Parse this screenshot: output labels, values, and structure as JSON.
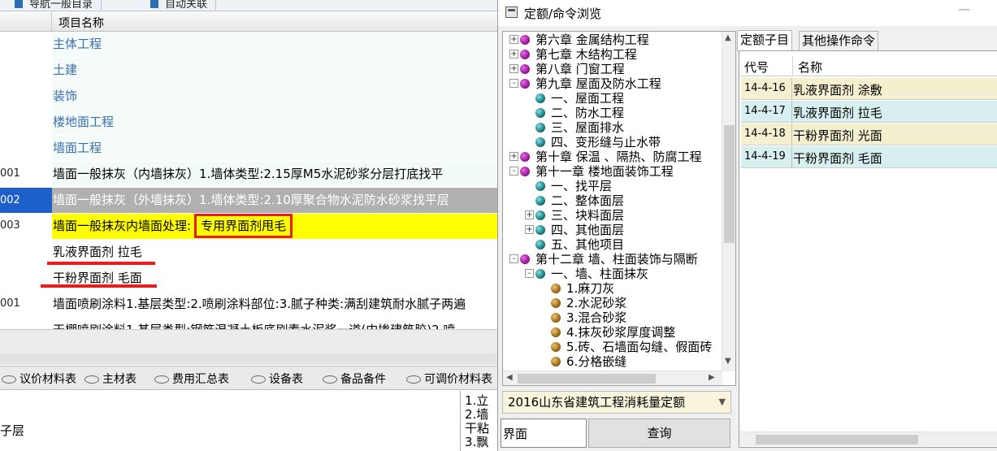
{
  "main": {
    "toolbar": [
      {
        "label": "导航一般目录"
      },
      {
        "label": "自动关联"
      }
    ],
    "column_header": "项目名称",
    "rows": [
      {
        "code": "",
        "text": "主体工程",
        "style": "group"
      },
      {
        "code": "",
        "text": "土建",
        "style": "group"
      },
      {
        "code": "",
        "text": "装饰",
        "style": "group"
      },
      {
        "code": "",
        "text": "楼地面工程",
        "style": "group"
      },
      {
        "code": "",
        "text": "墙面工程",
        "style": "group"
      },
      {
        "code": "001",
        "text": "墙面一般抹灰（内墙抹灰）1.墙体类型:2.15厚M5水泥砂浆分层打底找平",
        "style": "plain"
      },
      {
        "code": "002",
        "text": "墙面一般抹灰（外墙抹灰）1.墙体类型:2.10厚聚合物水泥防水砂浆找平层",
        "style": "selected"
      },
      {
        "code": "003",
        "text": "墙面一般抹灰内墙面处理:",
        "boxed": "专用界面剂甩毛",
        "style": "yellow"
      },
      {
        "code": "",
        "text": "乳液界面剂 拉毛",
        "style": "white"
      },
      {
        "code": "",
        "text": "干粉界面剂 毛面",
        "style": "white"
      },
      {
        "code": "001",
        "text": "墙面喷刷涂料1.基层类型:2.喷刷涂料部位:3.腻子种类:满刮建筑耐水腻子两遍",
        "style": "white"
      },
      {
        "code": "",
        "text": "天棚喷刷涂料1.基层类型:钢筋混凝土板底刷素水泥浆一道(内掺建筑胶)2.喷",
        "style": "white"
      }
    ],
    "bottom_tabs": [
      "议价材料表",
      "主材表",
      "费用汇总表",
      "设备表",
      "备品备件",
      "可调价材料表"
    ],
    "bottom_left_text": "子层",
    "bottom_right_lines": [
      "1.立",
      "2.墙",
      "干粘",
      "3.飘"
    ]
  },
  "dialog": {
    "title": "定额/命令浏览",
    "minimize": "—",
    "tree": [
      {
        "level": 0,
        "exp": "+",
        "icon": "purple",
        "label": "第六章 金属结构工程"
      },
      {
        "level": 0,
        "exp": "+",
        "icon": "purple",
        "label": "第七章 木结构工程"
      },
      {
        "level": 0,
        "exp": "+",
        "icon": "purple",
        "label": "第八章 门窗工程"
      },
      {
        "level": 0,
        "exp": "-",
        "icon": "purple",
        "label": "第九章 屋面及防水工程"
      },
      {
        "level": 1,
        "exp": "",
        "icon": "teal",
        "label": "一、屋面工程"
      },
      {
        "level": 1,
        "exp": "",
        "icon": "teal",
        "label": "二、防水工程"
      },
      {
        "level": 1,
        "exp": "",
        "icon": "teal",
        "label": "三、屋面排水"
      },
      {
        "level": 1,
        "exp": "",
        "icon": "teal",
        "label": "四、变形缝与止水带"
      },
      {
        "level": 0,
        "exp": "+",
        "icon": "purple",
        "label": "第十章 保温 、隔热、防腐工程"
      },
      {
        "level": 0,
        "exp": "-",
        "icon": "purple",
        "label": "第十一章 楼地面装饰工程"
      },
      {
        "level": 1,
        "exp": "",
        "icon": "teal",
        "label": "一、找平层"
      },
      {
        "level": 1,
        "exp": "",
        "icon": "teal",
        "label": "二、整体面层"
      },
      {
        "level": 1,
        "exp": "+",
        "icon": "teal",
        "label": "三、块料面层"
      },
      {
        "level": 1,
        "exp": "+",
        "icon": "teal",
        "label": "四、其他面层"
      },
      {
        "level": 1,
        "exp": "",
        "icon": "teal",
        "label": "五、其他项目"
      },
      {
        "level": 0,
        "exp": "-",
        "icon": "purple",
        "label": "第十二章 墙、柱面装饰与隔断"
      },
      {
        "level": 1,
        "exp": "-",
        "icon": "teal",
        "label": "一、墙、柱面抹灰"
      },
      {
        "level": 2,
        "exp": "",
        "icon": "brown",
        "label": "1.麻刀灰"
      },
      {
        "level": 2,
        "exp": "",
        "icon": "brown",
        "label": "2.水泥砂浆"
      },
      {
        "level": 2,
        "exp": "",
        "icon": "brown",
        "label": "3.混合砂浆"
      },
      {
        "level": 2,
        "exp": "",
        "icon": "brown",
        "label": "4.抹灰砂浆厚度调整"
      },
      {
        "level": 2,
        "exp": "",
        "icon": "brown",
        "label": "5.砖、石墙面勾缝、假面砖"
      },
      {
        "level": 2,
        "exp": "",
        "icon": "brown",
        "label": "6.分格嵌缝"
      }
    ],
    "quota_library": "2016山东省建筑工程消耗量定额",
    "search_value": "界面",
    "search_button": "查询",
    "tabs": [
      {
        "label": "定额子目",
        "active": true
      },
      {
        "label": "其他操作命令",
        "active": false
      }
    ],
    "table_headers": [
      "代号",
      "名称"
    ],
    "table_rows": [
      {
        "code": "14-4-16",
        "name": "乳液界面剂 涂敷"
      },
      {
        "code": "14-4-17",
        "name": "乳液界面剂 拉毛"
      },
      {
        "code": "14-4-18",
        "name": "干粉界面剂 光面"
      },
      {
        "code": "14-4-19",
        "name": "干粉界面剂 毛面"
      }
    ]
  }
}
